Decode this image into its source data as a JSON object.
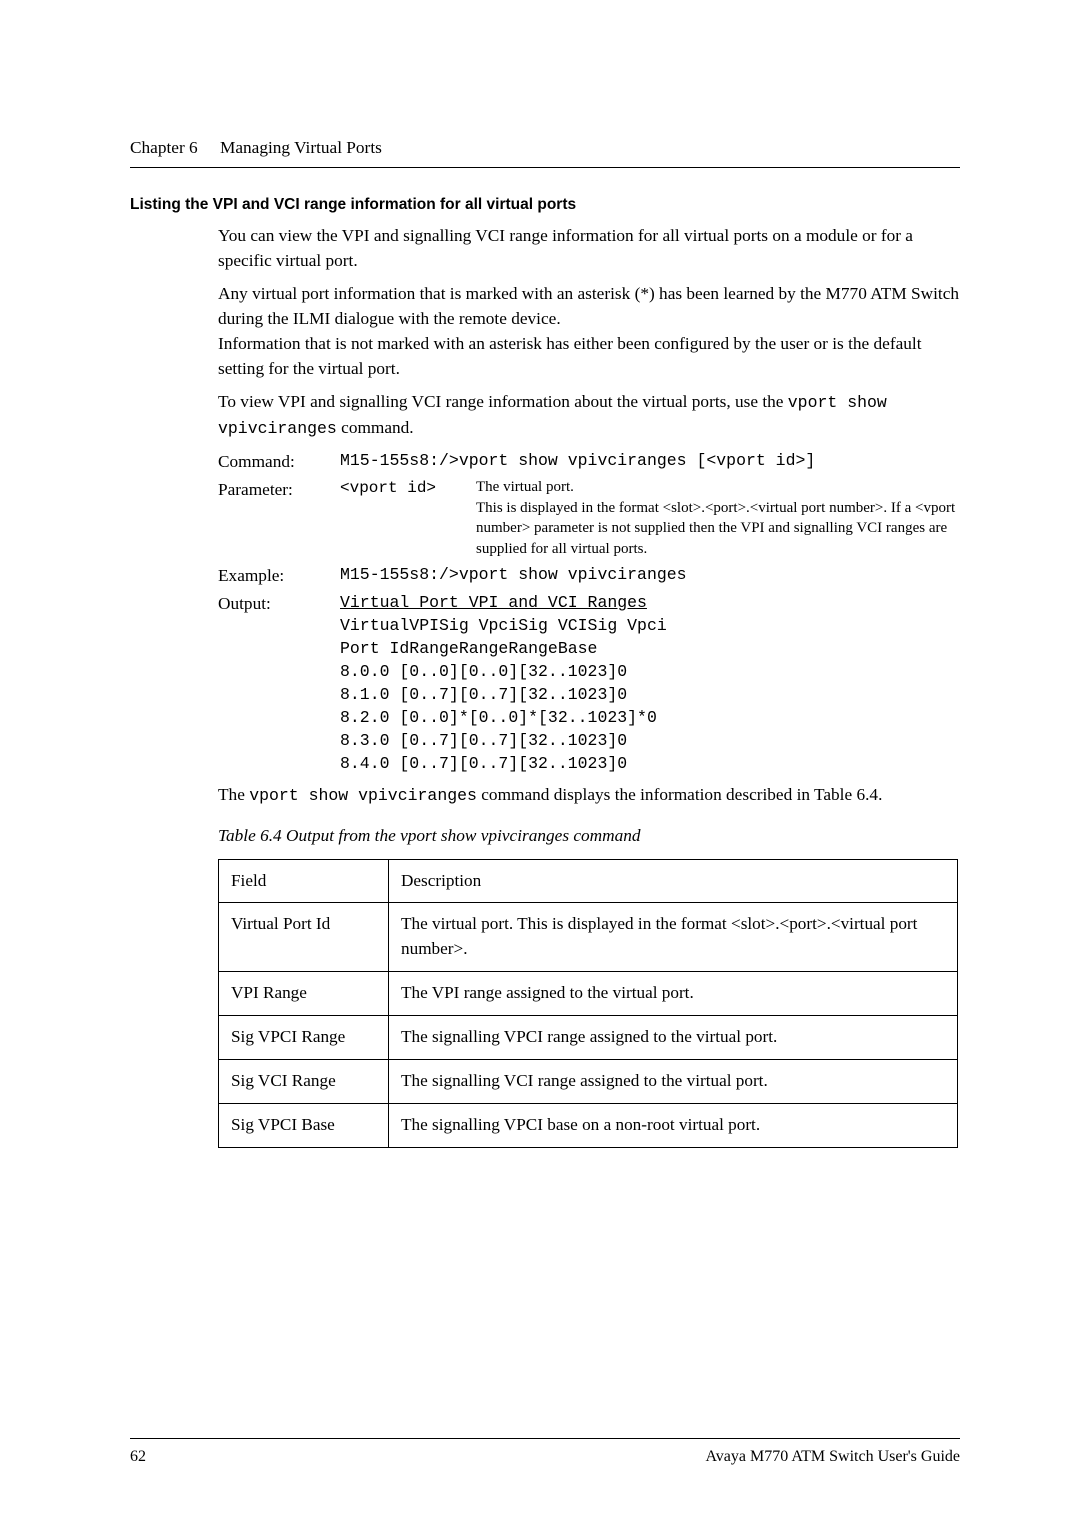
{
  "header": {
    "chapterLabel": "Chapter 6",
    "chapterTitle": "Managing Virtual Ports"
  },
  "sectionTitle": "Listing the VPI and VCI range information for all virtual ports",
  "intro1": "You can view the VPI and signalling VCI range information for all virtual ports on a module or for a specific virtual port.",
  "intro2a": "Any virtual port information that is marked with an asterisk (*) has been learned by the M770 ATM Switch during the ILMI dialogue with the remote device.",
  "intro2b": "Information that is not marked with an asterisk has either been configured by the user or is the default setting for the virtual port.",
  "intro3a": "To view VPI and signalling VCI range information about the virtual ports, use the ",
  "intro3cmd": "vport show vpivciranges",
  "intro3b": " command.",
  "def": {
    "commandLabel": "Command:",
    "commandValue": "M15-155s8:/>vport show vpivciranges [<vport id>]",
    "parameterLabel": "Parameter:",
    "paramId": "<vport id>",
    "paramDesc1": "The virtual port.",
    "paramDesc2": "This is displayed in the format <slot>.<port>.<virtual port number>. If a <vport number> parameter is not supplied then the VPI and signalling VCI ranges are supplied for all virtual ports.",
    "exampleLabel": "Example:",
    "exampleValue": "M15-155s8:/>vport show vpivciranges",
    "outputLabel": "Output:",
    "outputLines": [
      "Virtual Port VPI and VCI Ranges",
      "VirtualVPISig VpciSig VCISig Vpci",
      "Port IdRangeRangeRangeBase",
      "8.0.0  [0..0][0..0][32..1023]0",
      "8.1.0  [0..7][0..7][32..1023]0",
      "8.2.0  [0..0]*[0..0]*[32..1023]*0",
      "8.3.0  [0..7][0..7][32..1023]0",
      "8.4.0  [0..7][0..7][32..1023]0"
    ]
  },
  "afterDef1a": "The ",
  "afterDef1cmd": "vport show vpivciranges",
  "afterDef1b": " command displays the information described in Table 6.4.",
  "tableCaption": "Table 6.4       Output from the vport show vpivciranges command",
  "table": {
    "head": {
      "field": "Field",
      "desc": "Description"
    },
    "rows": [
      {
        "field": "Virtual Port Id",
        "desc": "The virtual port. This is displayed in the format <slot>.<port>.<virtual port number>."
      },
      {
        "field": "VPI Range",
        "desc": "The VPI range assigned to the virtual port."
      },
      {
        "field": "Sig VPCI Range",
        "desc": "The signalling VPCI range assigned to the virtual port."
      },
      {
        "field": "Sig VCI Range",
        "desc": "The signalling VCI range assigned to the virtual port."
      },
      {
        "field": "Sig VPCI Base",
        "desc": "The signalling VPCI base on a non-root virtual port."
      }
    ]
  },
  "footer": {
    "pageNum": "62",
    "bookTitle": "Avaya M770 ATM Switch User's Guide"
  }
}
